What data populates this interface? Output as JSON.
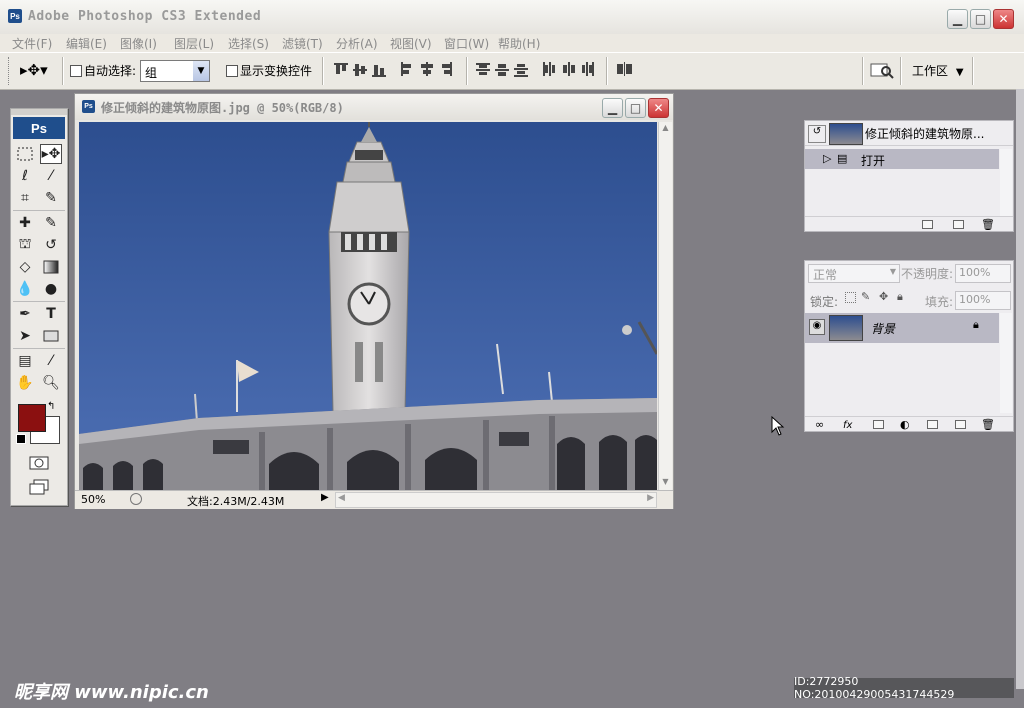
{
  "app": {
    "title": "Adobe Photoshop CS3 Extended",
    "logo": "Ps"
  },
  "menu": [
    "文件(F)",
    "编辑(E)",
    "图像(I)",
    "图层(L)",
    "选择(S)",
    "滤镜(T)",
    "分析(A)",
    "视图(V)",
    "窗口(W)",
    "帮助(H)"
  ],
  "options": {
    "auto_select_label": "自动选择:",
    "auto_select_value": "组",
    "show_transform_label": "显示变换控件",
    "workspace_label": "工作区"
  },
  "toolbox": {
    "logo": "Ps",
    "foreground_color": "#8b1010",
    "background_color": "#ffffff"
  },
  "document": {
    "title": "修正倾斜的建筑物原图.jpg @ 50%(RGB/8)",
    "zoom": "50%",
    "doc_info": "文档:2.43M/2.43M"
  },
  "history": {
    "snapshot_name": "修正倾斜的建筑物原...",
    "items": [
      {
        "label": "打开"
      }
    ]
  },
  "layers": {
    "blend_mode": "正常",
    "opacity_label": "不透明度:",
    "opacity_value": "100%",
    "lock_label": "锁定:",
    "fill_label": "填充:",
    "fill_value": "100%",
    "items": [
      {
        "name": "背景"
      }
    ]
  },
  "watermark": {
    "site": "昵享网 www.nipic.cn",
    "id_text": "ID:2772950 NO:20100429005431744529"
  }
}
